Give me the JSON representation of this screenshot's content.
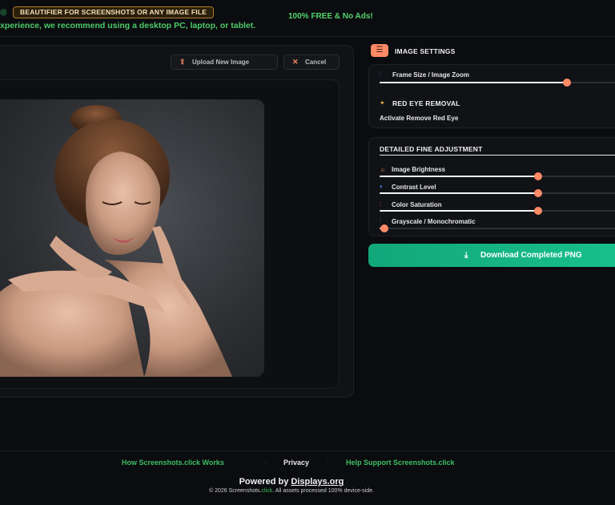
{
  "header": {
    "badge_label": "BEAUTIFIER FOR SCREENSHOTS OR ANY IMAGE FILE",
    "free_text": "100% FREE & No Ads!",
    "recommend_text": "xperience, we recommend using a desktop PC, laptop, or tablet."
  },
  "toolbar": {
    "upload_label": "Upload New Image",
    "cancel_label": "Cancel"
  },
  "settings": {
    "title": "IMAGE SETTINGS",
    "frame": {
      "label": "Frame Size / Image Zoom",
      "value": 0.78
    },
    "red_eye": {
      "title": "RED EYE REMOVAL",
      "action": "Activate Remove Red Eye"
    }
  },
  "fine_adjustment": {
    "title": "DETAILED FINE ADJUSTMENT",
    "sliders": [
      {
        "label": "Image Brightness",
        "value": 0.66,
        "icon": "sun-icon",
        "color": "#ff8a65"
      },
      {
        "label": "Contrast Level",
        "value": 0.66,
        "icon": "contrast-icon",
        "color": "#4d8dff"
      },
      {
        "label": "Color Saturation",
        "value": 0.66,
        "icon": "palette-icon",
        "color": "#ff6b8b"
      },
      {
        "label": "Grayscale / Monochromatic",
        "value": 0.02,
        "icon": "mono-icon",
        "color": "#8a8a8a"
      }
    ]
  },
  "download": {
    "label": "Download Completed PNG"
  },
  "footer": {
    "links": [
      "How Screenshots.click Works",
      "Privacy",
      "Help Support Screenshots.click"
    ],
    "powered_prefix": "Powered by ",
    "powered_brand": "Displays.org",
    "copyright_prefix": "© 2026 Screenshots.",
    "copyright_accent": "click",
    "copyright_suffix": ". All assets processed 100% device-side."
  },
  "colors": {
    "accent": "#ff8a65",
    "green": "#4ec96a",
    "download": "#14b07f"
  }
}
